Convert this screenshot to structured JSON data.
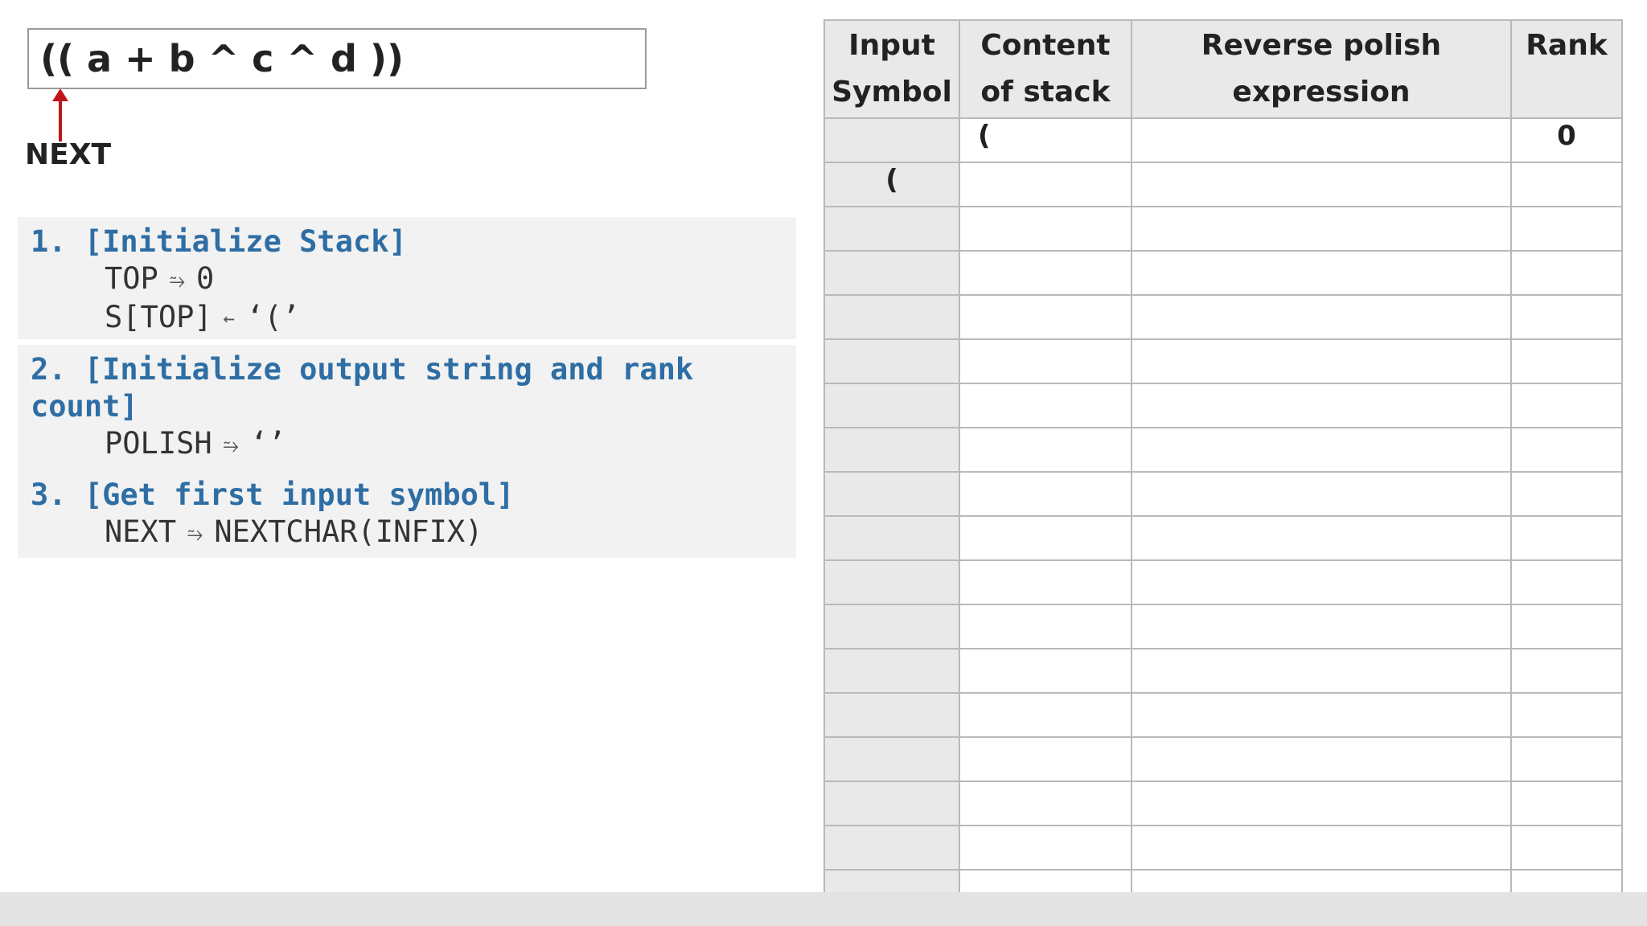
{
  "infix": {
    "expression": "(( a + b ^ c ^ d ))",
    "next_label": "NEXT",
    "arrow_color": "#c0151b"
  },
  "steps": [
    {
      "heading": "1. [Initialize Stack]",
      "lines": [
        "TOP",
        "0",
        "S[TOP]",
        "‘(’"
      ]
    },
    {
      "heading": "2. [Initialize output string and rank count]",
      "lines": [
        "POLISH",
        "‘’"
      ]
    },
    {
      "heading": "3. [Get first input symbol]",
      "lines": [
        "NEXT",
        "NEXTCHAR(INFIX)"
      ]
    }
  ],
  "table": {
    "headers": [
      "Input Symbol",
      "Content of stack",
      "Reverse polish expression",
      "Rank"
    ],
    "rows": [
      {
        "input": "",
        "stack": "(",
        "polish": "",
        "rank": "0"
      },
      {
        "input": "(",
        "stack": "",
        "polish": "",
        "rank": ""
      }
    ]
  },
  "colors": {
    "heading_blue": "#2e6ea4",
    "panel_gray": "#f2f2f2",
    "header_gray": "#e9e9e9",
    "grid_line": "#b9b9b9"
  }
}
